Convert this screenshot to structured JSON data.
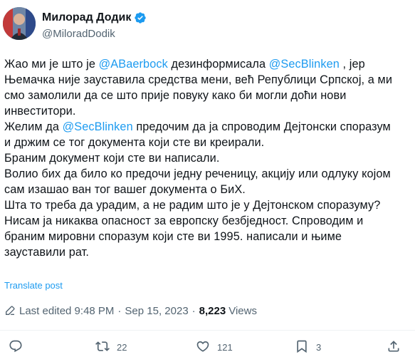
{
  "author": {
    "name": "Милорад Додик",
    "handle": "@MiloradDodik"
  },
  "tweet": {
    "lines": [
      [
        {
          "t": "Жао ми је што је "
        },
        {
          "t": "@ABaerbock",
          "m": true
        },
        {
          "t": " дезинформисала "
        },
        {
          "t": "@SecBlinken",
          "m": true
        },
        {
          "t": " , јер"
        }
      ],
      [
        {
          "t": "Њемачка није зауставила средства мени, већ Републици Српској, а ми"
        }
      ],
      [
        {
          "t": "смо замолили да се што прије повуку како би могли доћи нови"
        }
      ],
      [
        {
          "t": "инвеститори."
        }
      ],
      [
        {
          "t": "Желим да "
        },
        {
          "t": "@SecBlinken",
          "m": true
        },
        {
          "t": " предочим да ја спроводим Дејтонски споразум"
        }
      ],
      [
        {
          "t": "и држим се тог документа који сте ви креирали."
        }
      ],
      [
        {
          "t": "Браним документ који сте ви написали."
        }
      ],
      [
        {
          "t": "Волио бих да било ко предочи једну реченицу, акцију или одлуку којом"
        }
      ],
      [
        {
          "t": "сам изашао ван тог вашег документа о БиХ."
        }
      ],
      [
        {
          "t": "Шта то треба да урадим, а не радим што је у Дејтонском споразуму?"
        }
      ],
      [
        {
          "t": "Нисам ја никаква опасност за европску безбједност. Спроводим и"
        }
      ],
      [
        {
          "t": "браним мировни споразум који сте ви 1995. написали и њиме"
        }
      ],
      [
        {
          "t": "зауставили рат."
        }
      ]
    ]
  },
  "translate_label": "Translate post",
  "meta": {
    "edited": "Last edited 9:48 PM",
    "separator": "·",
    "date": "Sep 15, 2023",
    "views_count": "8,223",
    "views_label": "Views"
  },
  "actions": {
    "reply_count": "",
    "repost_count": "22",
    "like_count": "121",
    "bookmark_count": "3"
  },
  "colors": {
    "accent": "#1d9bf0",
    "text": "#0f1419",
    "muted": "#536471"
  },
  "icons": [
    "verified-badge-icon",
    "pencil-icon",
    "reply-icon",
    "repost-icon",
    "like-icon",
    "bookmark-icon",
    "share-icon"
  ]
}
